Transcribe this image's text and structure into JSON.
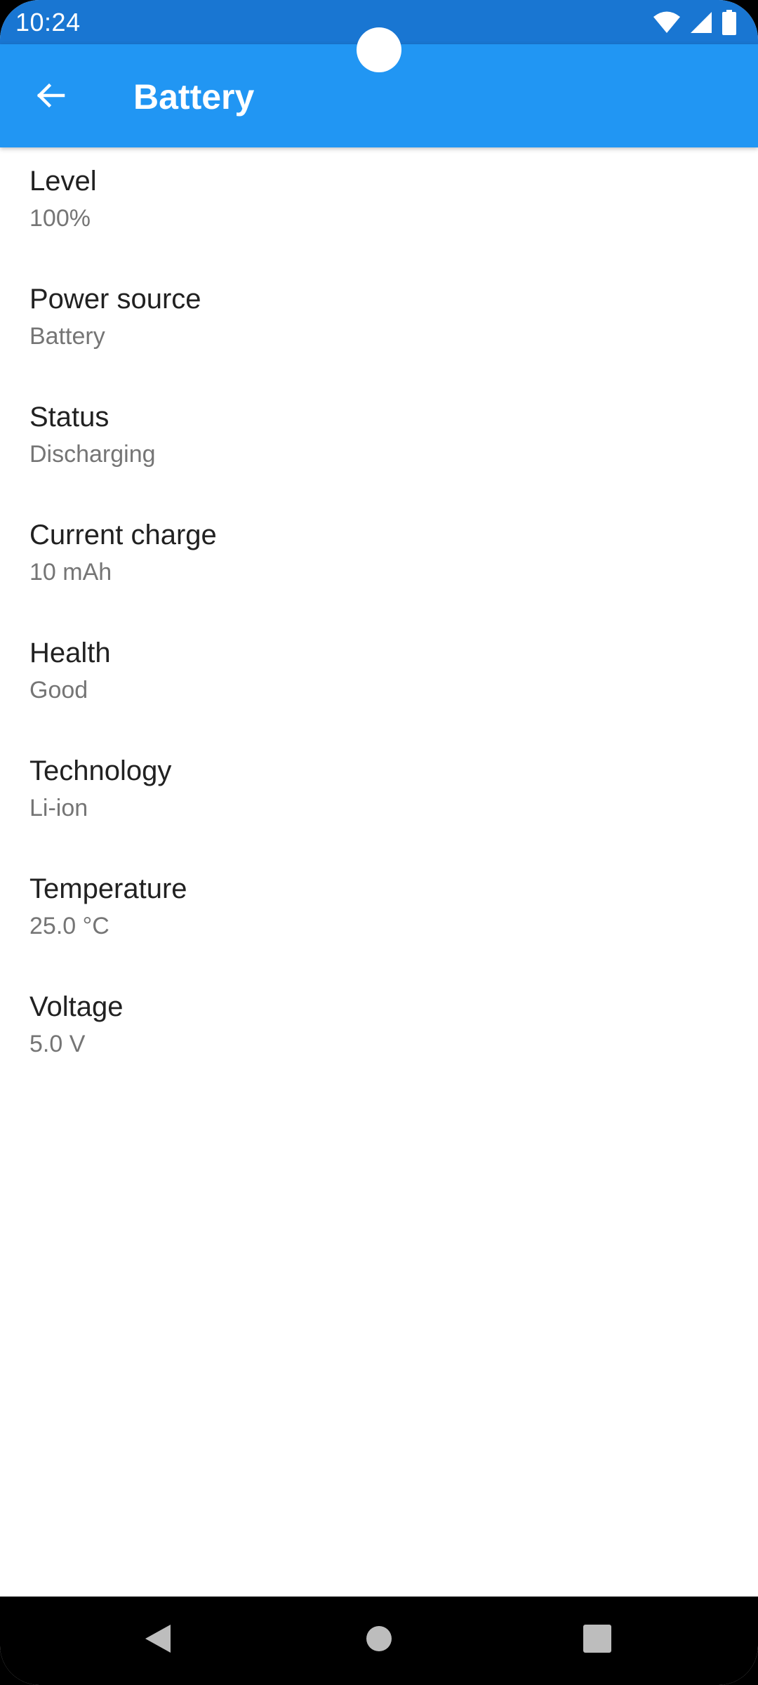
{
  "status_bar": {
    "time": "10:24",
    "icons": [
      "wifi-icon",
      "signal-icon",
      "battery-icon"
    ]
  },
  "app_bar": {
    "title": "Battery",
    "back_icon": "arrow-back-icon"
  },
  "items": [
    {
      "label": "Level",
      "value": "100%"
    },
    {
      "label": "Power source",
      "value": "Battery"
    },
    {
      "label": "Status",
      "value": "Discharging"
    },
    {
      "label": "Current charge",
      "value": "10 mAh"
    },
    {
      "label": "Health",
      "value": "Good"
    },
    {
      "label": "Technology",
      "value": "Li-ion"
    },
    {
      "label": "Temperature",
      "value": "25.0 °C"
    },
    {
      "label": "Voltage",
      "value": "5.0 V"
    }
  ],
  "nav_bar": {
    "buttons": [
      "back-triangle-icon",
      "home-circle-icon",
      "recents-square-icon"
    ]
  },
  "colors": {
    "status_bar": "#1976d2",
    "app_bar": "#2196f3",
    "label_text": "#212121",
    "value_text": "#757575"
  }
}
